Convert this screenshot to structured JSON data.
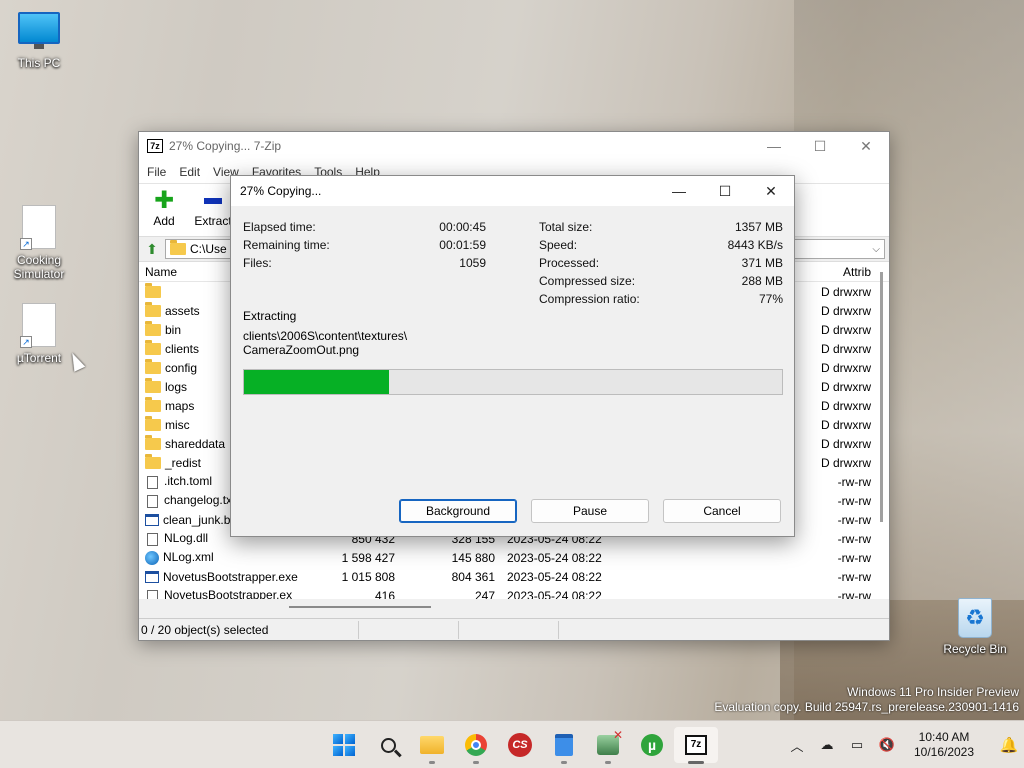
{
  "desktop": {
    "icons": [
      {
        "label": "This PC"
      },
      {
        "label": "Cooking Simulator"
      },
      {
        "label": "µTorrent"
      },
      {
        "label": "Recycle Bin"
      }
    ],
    "watermark_line1": "Windows 11 Pro Insider Preview",
    "watermark_line2": "Evaluation copy. Build 25947.rs_prerelease.230901-1416"
  },
  "zip_window": {
    "title": "27% Copying... 7-Zip",
    "logo": "7z",
    "menu": [
      "File",
      "Edit",
      "View",
      "Favorites",
      "Tools",
      "Help"
    ],
    "toolbar": {
      "add": "Add",
      "extract": "Extract"
    },
    "address": "C:\\Use",
    "columns": {
      "name": "Name",
      "attributes": "Attrib"
    },
    "rows": [
      {
        "name": "",
        "size": "",
        "packed": "",
        "date": "",
        "attr": "D drwxrw",
        "type": "folder"
      },
      {
        "name": "assets",
        "size": "",
        "packed": "",
        "date": "",
        "attr": "D drwxrw",
        "type": "folder"
      },
      {
        "name": "bin",
        "size": "",
        "packed": "",
        "date": "",
        "attr": "D drwxrw",
        "type": "folder"
      },
      {
        "name": "clients",
        "size": "",
        "packed": "",
        "date": "",
        "attr": "D drwxrw",
        "type": "folder"
      },
      {
        "name": "config",
        "size": "",
        "packed": "",
        "date": "",
        "attr": "D drwxrw",
        "type": "folder"
      },
      {
        "name": "logs",
        "size": "",
        "packed": "",
        "date": "",
        "attr": "D drwxrw",
        "type": "folder"
      },
      {
        "name": "maps",
        "size": "",
        "packed": "",
        "date": "",
        "attr": "D drwxrw",
        "type": "folder"
      },
      {
        "name": "misc",
        "size": "",
        "packed": "",
        "date": "",
        "attr": "D drwxrw",
        "type": "folder"
      },
      {
        "name": "shareddata",
        "size": "",
        "packed": "",
        "date": "",
        "attr": "D drwxrw",
        "type": "folder"
      },
      {
        "name": "_redist",
        "size": "",
        "packed": "",
        "date": "",
        "attr": "D drwxrw",
        "type": "folder"
      },
      {
        "name": ".itch.toml",
        "size": "",
        "packed": "",
        "date": "",
        "attr": "-rw-rw",
        "type": "file"
      },
      {
        "name": "changelog.tx",
        "size": "",
        "packed": "",
        "date": "",
        "attr": "-rw-rw",
        "type": "file"
      },
      {
        "name": "clean_junk.ba",
        "size": "",
        "packed": "",
        "date": "",
        "attr": "-rw-rw",
        "type": "bat"
      },
      {
        "name": "NLog.dll",
        "size": "850 432",
        "packed": "328 155",
        "date": "2023-05-24 08:22",
        "attr": "-rw-rw",
        "type": "file"
      },
      {
        "name": "NLog.xml",
        "size": "1 598 427",
        "packed": "145 880",
        "date": "2023-05-24 08:22",
        "attr": "-rw-rw",
        "type": "xml"
      },
      {
        "name": "NovetusBootstrapper.exe",
        "size": "1 015 808",
        "packed": "804 361",
        "date": "2023-05-24 08:22",
        "attr": "-rw-rw",
        "type": "exe"
      },
      {
        "name": "NovetusBootstrapper.ex",
        "size": "416",
        "packed": "247",
        "date": "2023-05-24 08:22",
        "attr": "-rw-rw",
        "type": "file"
      }
    ],
    "status": "0 / 20 object(s) selected"
  },
  "progress_dialog": {
    "title": "27% Copying...",
    "left_stats": [
      {
        "label": "Elapsed time:",
        "value": "00:00:45"
      },
      {
        "label": "Remaining time:",
        "value": "00:01:59"
      },
      {
        "label": "Files:",
        "value": "1059"
      }
    ],
    "right_stats": [
      {
        "label": "Total size:",
        "value": "1357 MB"
      },
      {
        "label": "Speed:",
        "value": "8443 KB/s"
      },
      {
        "label": "Processed:",
        "value": "371 MB"
      },
      {
        "label": "Compressed size:",
        "value": "288 MB"
      },
      {
        "label": "Compression ratio:",
        "value": "77%"
      }
    ],
    "operation": "Extracting",
    "path_line1": "clients\\2006S\\content\\textures\\",
    "path_line2": "CameraZoomOut.png",
    "progress_fraction": 0.27,
    "buttons": {
      "background": "Background",
      "pause": "Pause",
      "cancel": "Cancel"
    },
    "progress_color": "#06b025"
  },
  "taskbar": {
    "apps": [
      "start-icon",
      "search-icon",
      "file-explorer-icon",
      "chrome-icon",
      "cs-icon",
      "notepad-icon",
      "game-icon",
      "utorrent-icon",
      "7zip-icon"
    ],
    "cs_text": "CS",
    "ut_text": "µ",
    "z7_text": "7z",
    "time": "10:40 AM",
    "date": "10/16/2023"
  }
}
